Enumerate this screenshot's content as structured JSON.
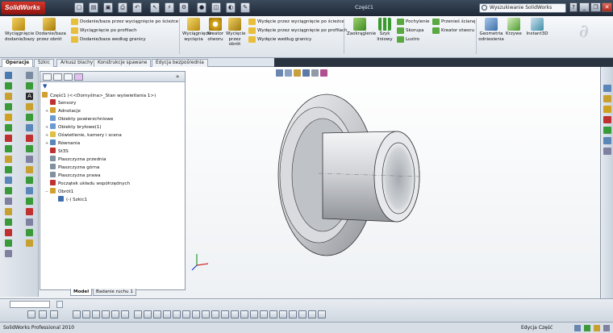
{
  "app": {
    "logo_text": "SolidWorks",
    "document_title": "Część1"
  },
  "search": {
    "placeholder": "Wyszukiwanie SolidWorks"
  },
  "window_controls": {
    "minimize": "_",
    "restore": "❐",
    "close": "✕"
  },
  "command_manager": {
    "features": {
      "extruded_boss": "Wyciągnięcie dodanie/bazy",
      "revolved_boss": "Dodanie/baza przez obrót",
      "swept_boss": "Dodanie/baza przez wyciągnięcie po ścieżce",
      "lofted_boss": "Wyciągnięcie po profilach",
      "boundary_boss": "Dodanie/baza według granicy",
      "extruded_cut": "Wyciągnięcie wycięcia",
      "hole_wizard": "Kreator otworu",
      "revolved_cut": "Wycięcie przez obrót",
      "swept_cut": "Wydęcie przez wyciągnięcie po ścieżce",
      "lofted_cut": "Wydęcie przez wyciągnięcie po profilach",
      "boundary_cut": "Wydęcie według granicy",
      "fillet": "Zaokrąglenie",
      "linear_pattern": "Szyk liniowy",
      "draft": "Pochylenie",
      "shell": "Skorupa",
      "mirror": "Lustro",
      "rib": "Przenieś ścianę",
      "wrap": "Kreator otworu",
      "ref_geometry": "Geometria odniesienia",
      "curves": "Krzywe",
      "instant3d": "Instant3D"
    }
  },
  "tabs": [
    "Operacje",
    "Szkic",
    "Arkusz blachy",
    "Konstrukcje spawane",
    "Edycja bezpośrednia"
  ],
  "feature_tree": {
    "filter_icon": "filter-icon",
    "root": "Część1  (<<Domyślna>_Stan wyświetlania 1>)",
    "items": [
      {
        "label": "Sensory",
        "expander": ""
      },
      {
        "label": "Adnotacje",
        "expander": "+"
      },
      {
        "label": "Obiekty powierzchniowe",
        "expander": ""
      },
      {
        "label": "Obiekty bryłowe(1)",
        "expander": "+"
      },
      {
        "label": "Oświetlenie, kamery i scena",
        "expander": "+"
      },
      {
        "label": "Równania",
        "expander": "+"
      },
      {
        "label": "St3S",
        "expander": ""
      },
      {
        "label": "Płaszczyzna przednia",
        "expander": ""
      },
      {
        "label": "Płaszczyzna górna",
        "expander": ""
      },
      {
        "label": "Płaszczyzna prawa",
        "expander": ""
      },
      {
        "label": "Początek układu współrzędnych",
        "expander": ""
      },
      {
        "label": "Obrót1",
        "expander": "−"
      },
      {
        "label": "(-) Szkic1",
        "expander": ""
      }
    ]
  },
  "bottom_tabs": [
    "Model",
    "Badanie ruchu 1"
  ],
  "status": {
    "left": "SolidWorks Professional 2010",
    "mode": "Edycja Część"
  },
  "colors": {
    "accent_red": "#c8281f",
    "viewport_top": "#ffffff",
    "part_gray": "#c8c9cc"
  }
}
